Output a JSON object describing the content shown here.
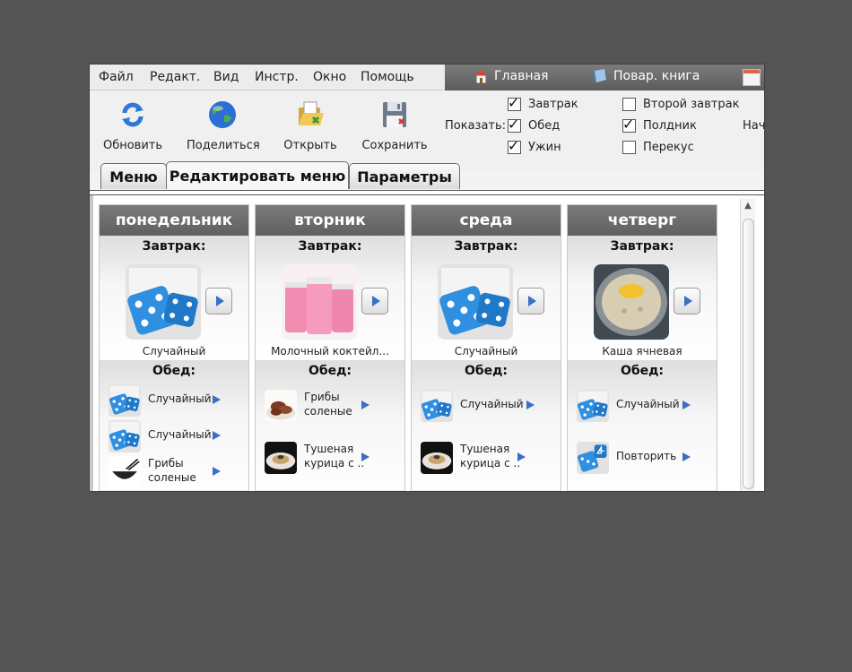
{
  "menu": [
    "Файл",
    "Редакт.",
    "Вид",
    "Инстр.",
    "Окно",
    "Помощь"
  ],
  "nav": {
    "home": "Главная",
    "cookbook": "Повар. книга"
  },
  "toolbar": {
    "refresh": "Обновить",
    "share": "Поделиться",
    "open": "Открыть",
    "save": "Сохранить"
  },
  "show": {
    "label": "Показать:",
    "options": [
      {
        "label": "Завтрак",
        "checked": true
      },
      {
        "label": "Обед",
        "checked": true
      },
      {
        "label": "Ужин",
        "checked": true
      },
      {
        "label": "Второй завтрак",
        "checked": false
      },
      {
        "label": "Полдник",
        "checked": true
      },
      {
        "label": "Перекус",
        "checked": false
      }
    ],
    "cut_label": "Нач"
  },
  "tabs": [
    "Меню",
    "Редактировать меню",
    "Параметры"
  ],
  "active_tab": "Редактировать меню",
  "days": [
    {
      "name": "понедельник",
      "breakfast_label": "Завтрак:",
      "breakfast": {
        "name": "Случайный",
        "image": "dice"
      },
      "lunch_label": "Обед:",
      "lunch": [
        {
          "name": "Случайный",
          "image": "dice"
        },
        {
          "name": "Случайный",
          "image": "dice"
        },
        {
          "name": "Грибы соленые",
          "image": "bowl"
        }
      ]
    },
    {
      "name": "вторник",
      "breakfast_label": "Завтрак:",
      "breakfast": {
        "name": "Молочный коктейл...",
        "image": "milkshake"
      },
      "lunch_label": "Обед:",
      "lunch": [
        {
          "name": "Грибы соленые",
          "image": "mushrooms"
        },
        {
          "name": "Тушеная курица с ..",
          "image": "chicken"
        }
      ]
    },
    {
      "name": "среда",
      "breakfast_label": "Завтрак:",
      "breakfast": {
        "name": "Случайный",
        "image": "dice"
      },
      "lunch_label": "Обед:",
      "lunch": [
        {
          "name": "Случайный",
          "image": "dice"
        },
        {
          "name": "Тушеная курица с ..",
          "image": "chicken"
        }
      ]
    },
    {
      "name": "четверг",
      "breakfast_label": "Завтрак:",
      "breakfast": {
        "name": "Каша ячневая",
        "image": "porridge"
      },
      "lunch_label": "Обед:",
      "lunch": [
        {
          "name": "Случайный",
          "image": "dice"
        },
        {
          "name": "Повторить",
          "image": "dice-repeat"
        }
      ]
    }
  ]
}
